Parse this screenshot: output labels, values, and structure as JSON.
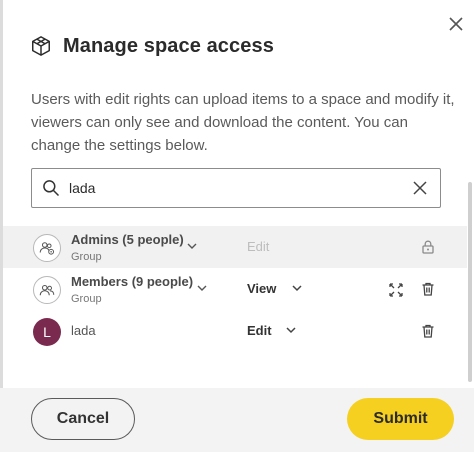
{
  "dialog": {
    "title": "Manage space access",
    "logo_icon": "cube-icon",
    "close_icon": "close-icon",
    "description": "Users with edit rights can upload items to a space and modify it, viewers can only see and download the content. You can change the settings below."
  },
  "search": {
    "value": "lada",
    "icon": "search-icon",
    "clear_icon": "clear-icon"
  },
  "members": [
    {
      "name": "Admins (5 people)",
      "type": "Group",
      "role": "Edit",
      "role_disabled": true,
      "avatar_icon": "group-admin-icon",
      "actions": [
        "lock-icon"
      ]
    },
    {
      "name": "Members (9 people)",
      "type": "Group",
      "role": "View",
      "role_disabled": false,
      "avatar_icon": "group-icon",
      "actions": [
        "expand-icon",
        "trash-icon"
      ]
    },
    {
      "name": "lada",
      "initial": "L",
      "role": "Edit",
      "role_disabled": false,
      "avatar_color": "#7a2a4e",
      "actions": [
        "trash-icon"
      ]
    }
  ],
  "footer": {
    "cancel_label": "Cancel",
    "submit_label": "Submit"
  },
  "colors": {
    "accent": "#f5d020",
    "avatar_lada": "#7a2a4e",
    "highlight_row": "#f1f1f1"
  }
}
